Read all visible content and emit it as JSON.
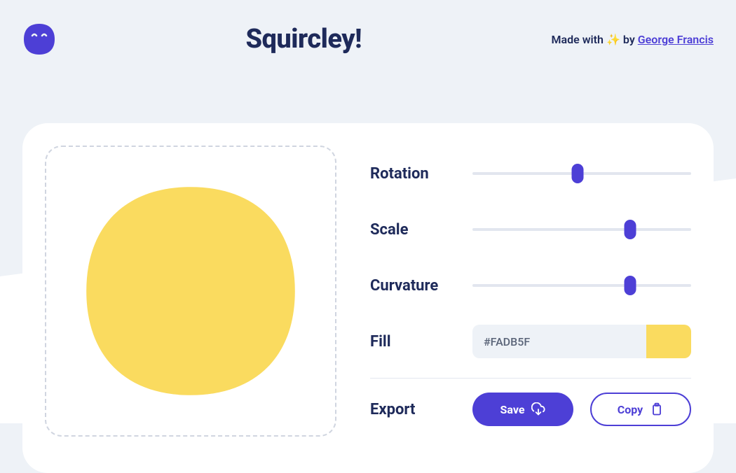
{
  "header": {
    "title": "Squircley!",
    "credit_prefix": "Made with",
    "credit_by": "by",
    "credit_author": "George Francis"
  },
  "controls": {
    "rotation": {
      "label": "Rotation",
      "value_percent": 48
    },
    "scale": {
      "label": "Scale",
      "value_percent": 72
    },
    "curvature": {
      "label": "Curvature",
      "value_percent": 72
    },
    "fill": {
      "label": "Fill",
      "value": "#FADB5F"
    },
    "export": {
      "label": "Export",
      "save_label": "Save",
      "copy_label": "Copy"
    }
  },
  "colors": {
    "accent": "#4d3fd6",
    "shape_fill": "#FADB5F",
    "text_dark": "#1e2a5a",
    "bg": "#eef2f7"
  }
}
